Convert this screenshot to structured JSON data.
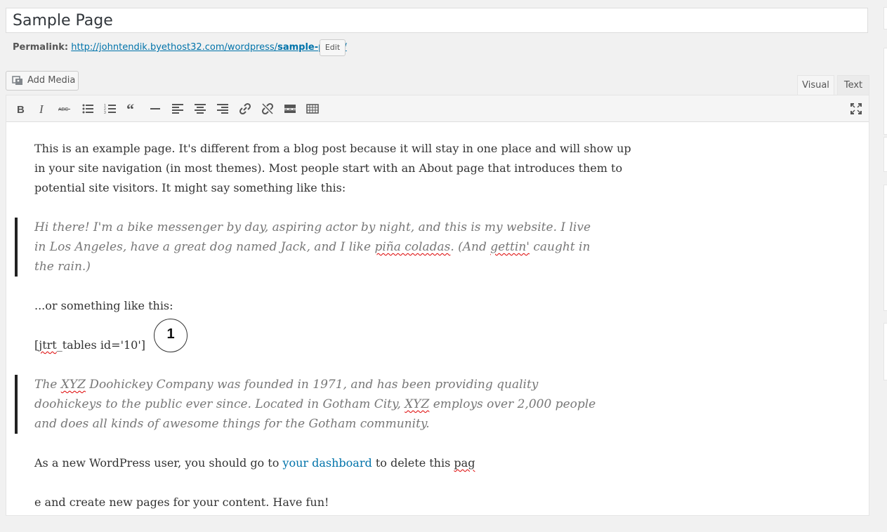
{
  "title": {
    "value": "Sample Page"
  },
  "permalink": {
    "label": "Permalink:",
    "url_base": "http://johntendik.byethost32.com/wordpress/",
    "slug": "sample-page",
    "trailing": "/",
    "edit_label": "Edit"
  },
  "media": {
    "add_label": "Add Media",
    "icon": "media-icon"
  },
  "tabs": {
    "visual": "Visual",
    "text": "Text"
  },
  "toolbar": {
    "buttons": [
      "bold",
      "italic",
      "strikethrough",
      "bulleted-list",
      "numbered-list",
      "blockquote",
      "horizontal-line",
      "align-left",
      "align-center",
      "align-right",
      "insert-link",
      "remove-link",
      "read-more",
      "toolbar-toggle",
      "fullscreen"
    ]
  },
  "content": {
    "para1": "This is an example page. It's different from a blog post because it will stay in one place and will show up in your site navigation (in most themes). Most people start with an About page that introduces them to potential site visitors. It might say something like this:",
    "quote1_a": "Hi there! I'm a bike messenger by day, aspiring actor by night, and this is my website. I live in Los Angeles, have a great dog named Jack, and I like ",
    "quote1_b": "piña coladas",
    "quote1_c": ". (And ",
    "quote1_d": "gettin'",
    "quote1_e": " caught in the rain.)",
    "para2": "...or something like this:",
    "shortcode_a": "[",
    "shortcode_b": "jtrt",
    "shortcode_c": "_tables id='10']",
    "quote2_a": "The ",
    "quote2_b": "XYZ",
    "quote2_c": " Doohickey Company was founded in 1971, and has been providing quality doohickeys to the public ever since. Located in Gotham City, ",
    "quote2_d": "XYZ",
    "quote2_e": " employs over 2,000 people and does all kinds of awesome things for the Gotham community.",
    "para3_a": "As a new WordPress user, you should go to ",
    "para3_link": "your dashboard",
    "para3_b": " to delete this ",
    "para3_c": "pag",
    "para4": "e and create new pages for your content. Have fun!"
  },
  "annotation": {
    "marker": "1"
  }
}
